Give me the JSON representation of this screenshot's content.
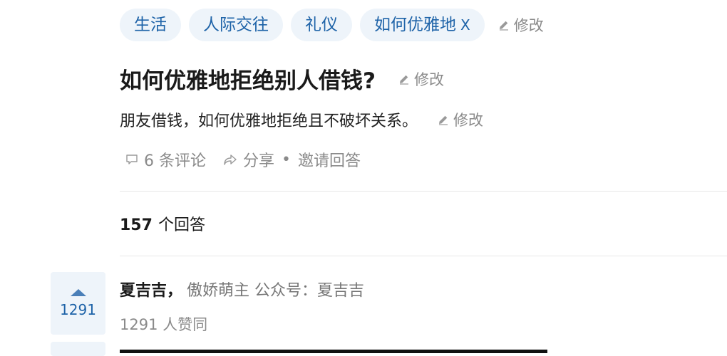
{
  "topics": [
    {
      "label": "生活"
    },
    {
      "label": "人际交往"
    },
    {
      "label": "礼仪"
    },
    {
      "label": "如何优雅地",
      "remove": "X"
    }
  ],
  "edit_label": "修改",
  "question": {
    "title": "如何优雅地拒绝别人借钱?",
    "detail": "朋友借钱，如何优雅地拒绝且不破坏关系。"
  },
  "actions": {
    "comments": "6 条评论",
    "share": "分享",
    "separator": "•",
    "invite": "邀请回答"
  },
  "answers": {
    "count": "157",
    "count_label": "个回答"
  },
  "first_answer": {
    "votes": "1291",
    "author_name": "夏吉吉，",
    "author_bio": "傲娇萌主 公众号：夏吉吉",
    "likes": "1291 人赞同"
  },
  "colors": {
    "tag_bg": "#eef4fa",
    "tag_text": "#1e63a8",
    "muted": "#8a8a8a"
  }
}
